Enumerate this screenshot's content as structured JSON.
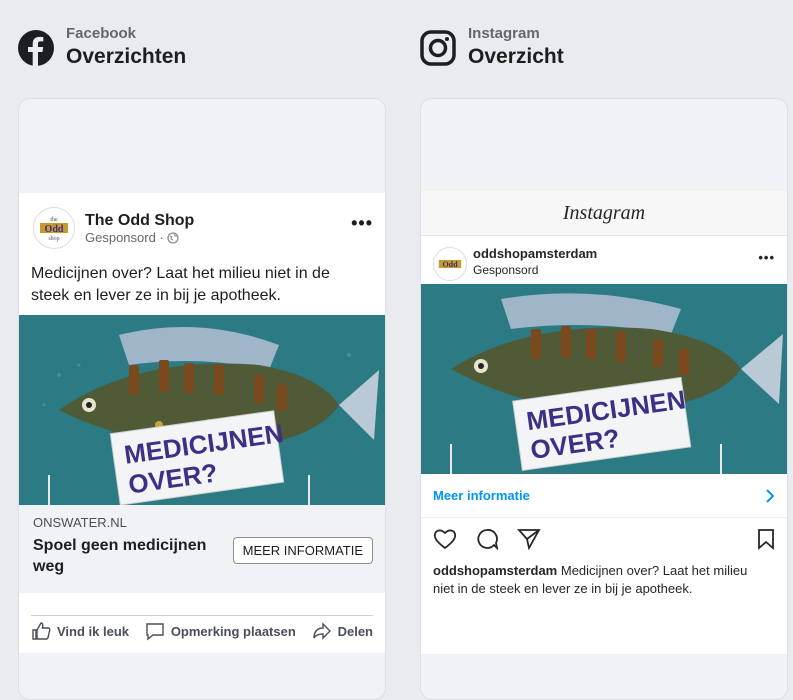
{
  "facebook": {
    "network": "Facebook",
    "title": "Overzichten",
    "page_name": "The Odd Shop",
    "sponsored": "Gesponsord ·",
    "text": "Medicijnen over? Laat het milieu niet in de steek en lever ze in bij je apotheek.",
    "domain": "ONSWATER.NL",
    "headline": "Spoel geen medicijnen weg",
    "cta": "MEER INFORMATIE",
    "actions": [
      "Vind ik leuk",
      "Opmerking plaatsen",
      "Delen"
    ]
  },
  "instagram": {
    "network": "Instagram",
    "title": "Overzicht",
    "wordmark": "Instagram",
    "username": "oddshopamsterdam",
    "sponsored": "Gesponsord",
    "cta": "Meer informatie",
    "caption_user": "oddshopamsterdam",
    "caption_text": "Medicijnen over? Laat het milieu niet in de steek en lever ze in bij je apotheek."
  },
  "creative": {
    "line1": "MEDICIJNEN",
    "line2": "OVER?"
  },
  "colors": {
    "facebook_blue": "#1877f2",
    "creative_bg": "#2c7a83",
    "headline_purple": "#3d2f86",
    "link_blue": "#0095f6"
  }
}
